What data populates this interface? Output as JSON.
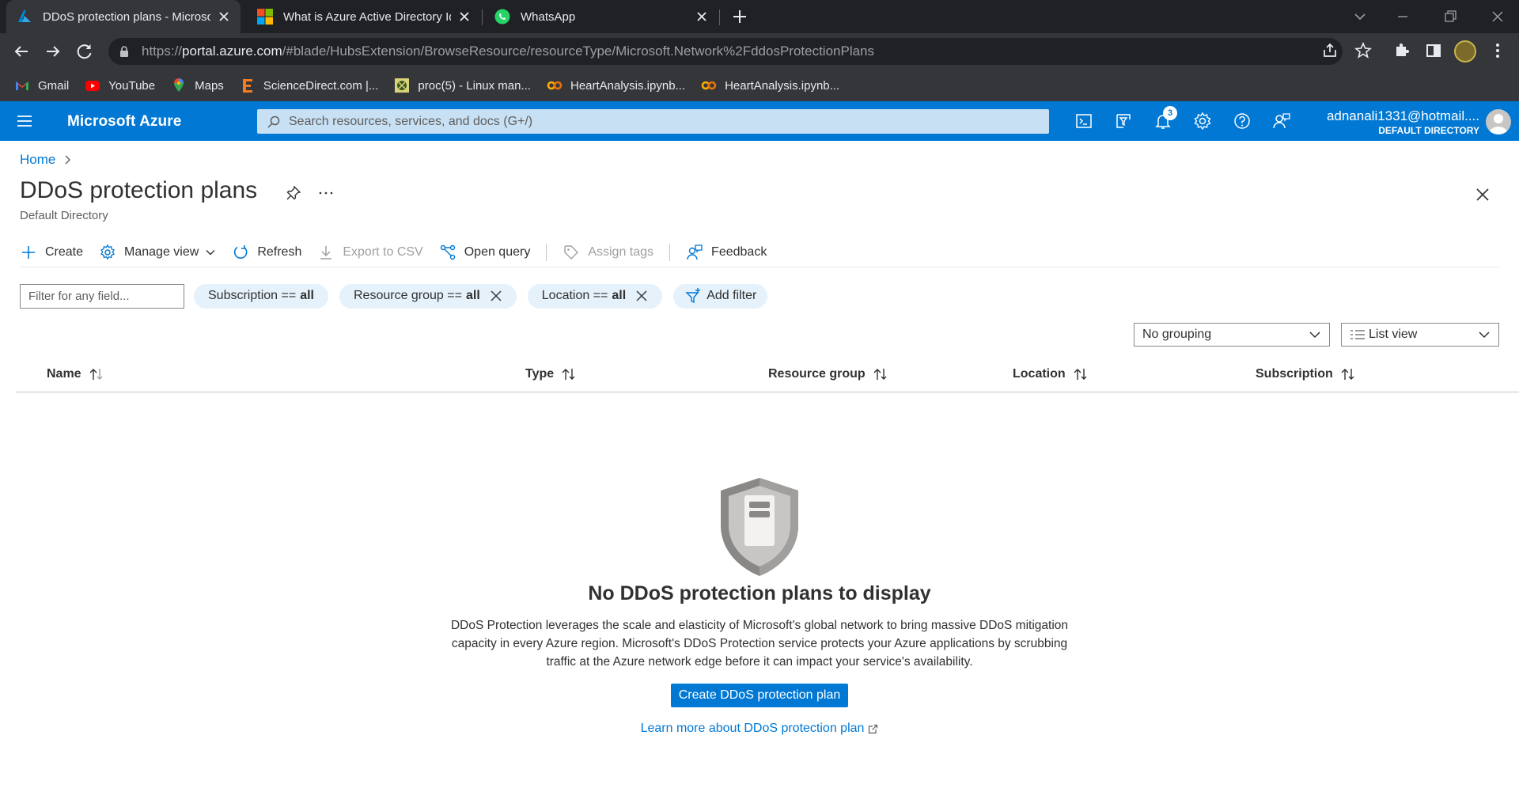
{
  "browser": {
    "tabs": [
      {
        "title": "DDoS protection plans - Microso",
        "active": true
      },
      {
        "title": "What is Azure Active Directory Id",
        "active": false
      },
      {
        "title": "WhatsApp",
        "active": false
      }
    ],
    "url_prefix": "https://",
    "url_domain": "portal.azure.com",
    "url_path": "/#blade/HubsExtension/BrowseResource/resourceType/Microsoft.Network%2FddosProtectionPlans",
    "bookmarks": [
      {
        "label": "Gmail",
        "icon": "gmail-icon"
      },
      {
        "label": "YouTube",
        "icon": "youtube-icon"
      },
      {
        "label": "Maps",
        "icon": "maps-icon"
      },
      {
        "label": "ScienceDirect.com |...",
        "icon": "sciencedirect-icon"
      },
      {
        "label": "proc(5) - Linux man...",
        "icon": "linux-man-icon"
      },
      {
        "label": "HeartAnalysis.ipynb...",
        "icon": "colab-icon"
      },
      {
        "label": "HeartAnalysis.ipynb...",
        "icon": "colab-icon"
      }
    ]
  },
  "azure": {
    "brand": "Microsoft Azure",
    "search_placeholder": "Search resources, services, and docs (G+/)",
    "notification_count": "3",
    "account_email": "adnanali1331@hotmail....",
    "account_directory": "DEFAULT DIRECTORY"
  },
  "page": {
    "breadcrumb_home": "Home",
    "title": "DDoS protection plans",
    "subtitle": "Default Directory",
    "commands": {
      "create": "Create",
      "manage_view": "Manage view",
      "refresh": "Refresh",
      "export_csv": "Export to CSV",
      "open_query": "Open query",
      "assign_tags": "Assign tags",
      "feedback": "Feedback"
    },
    "filter_placeholder": "Filter for any field...",
    "filters": {
      "subscription_label": "Subscription ==",
      "subscription_value": "all",
      "resource_group_label": "Resource group ==",
      "resource_group_value": "all",
      "location_label": "Location ==",
      "location_value": "all",
      "add_filter": "Add filter"
    },
    "grouping_value": "No grouping",
    "view_value": "List view",
    "columns": [
      "Name",
      "Type",
      "Resource group",
      "Location",
      "Subscription"
    ],
    "empty_state": {
      "title": "No DDoS protection plans to display",
      "description_line1": "DDoS Protection leverages the scale and elasticity of Microsoft's global network to bring massive DDoS mitigation",
      "description_line2": "capacity in every Azure region. Microsoft's DDoS Protection service protects your Azure applications by scrubbing",
      "description_line3": "traffic at the Azure network edge before it can impact your service's availability.",
      "create_button": "Create DDoS protection plan",
      "learn_more": "Learn more about DDoS protection plan"
    }
  },
  "colors": {
    "azure_blue": "#0078d4",
    "search_bg": "#c7e0f4",
    "pill_bg": "#e5f1fb",
    "chrome_dark": "#202124",
    "chrome_toolbar": "#35363a"
  }
}
